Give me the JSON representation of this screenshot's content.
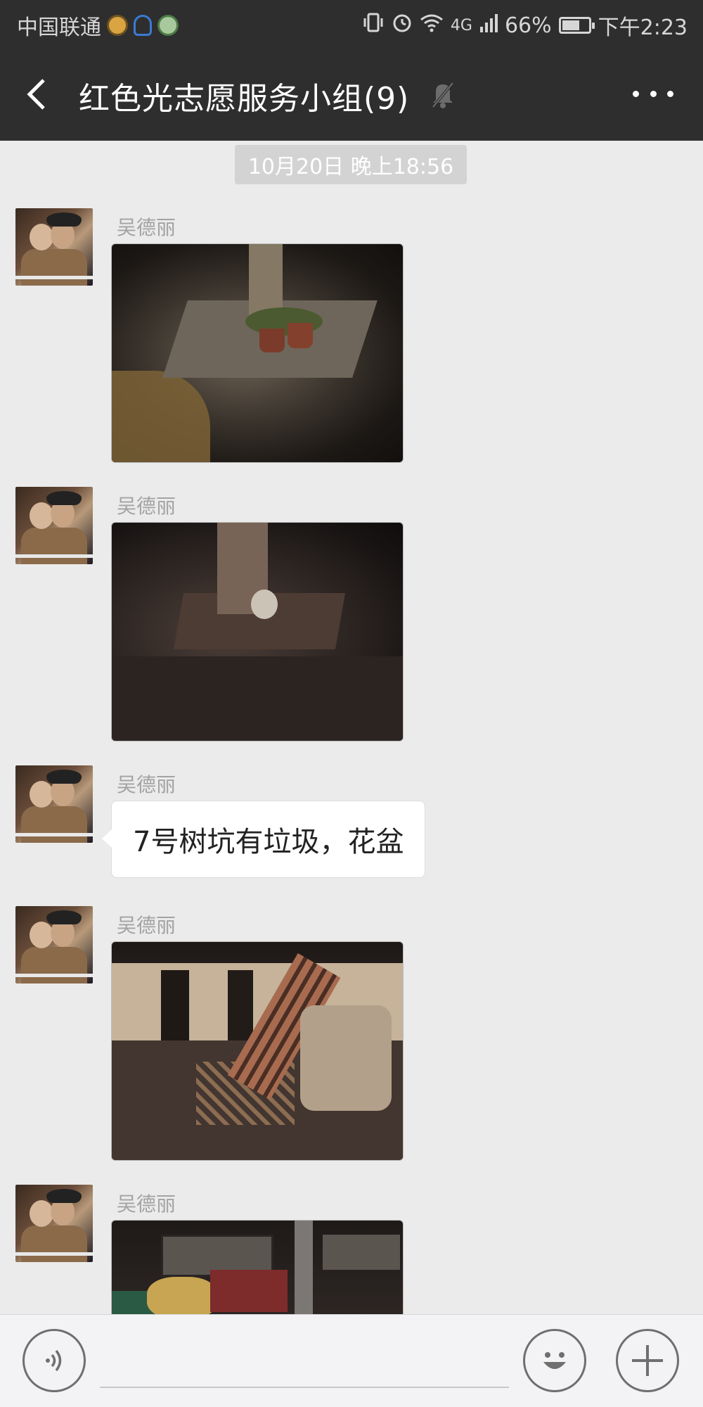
{
  "status_bar": {
    "carrier": "中国联通",
    "network": "4G",
    "battery": "66%",
    "time": "下午2:23"
  },
  "header": {
    "title": "红色光志愿服务小组(9)",
    "back_icon": "chevron-left-icon",
    "mute_icon": "muted-bell-icon",
    "more_icon": "more-dots-icon"
  },
  "chat": {
    "timestamp": "10月20日 晚上18:56",
    "messages": [
      {
        "sender": "吴德丽",
        "type": "image"
      },
      {
        "sender": "吴德丽",
        "type": "image"
      },
      {
        "sender": "吴德丽",
        "type": "text",
        "text": "7号树坑有垃圾，花盆"
      },
      {
        "sender": "吴德丽",
        "type": "image"
      },
      {
        "sender": "吴德丽",
        "type": "image"
      }
    ]
  },
  "input_bar": {
    "voice_icon": "voice-icon",
    "emoji_icon": "emoji-icon",
    "plus_icon": "plus-icon",
    "placeholder": ""
  }
}
